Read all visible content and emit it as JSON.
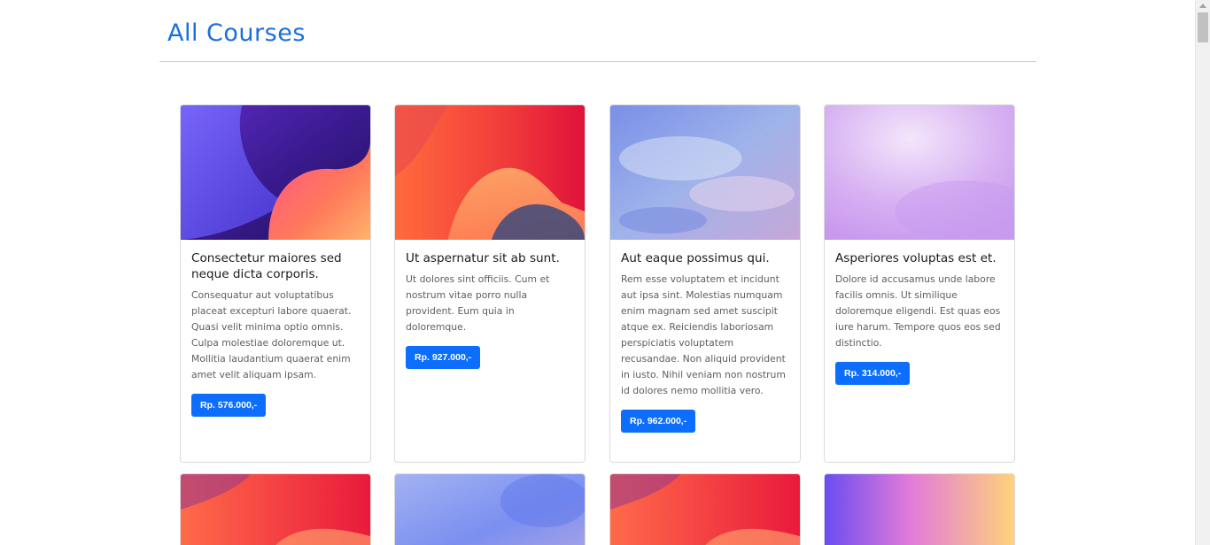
{
  "page": {
    "title": "All Courses"
  },
  "courses": [
    {
      "title": "Consectetur maiores sed neque dicta corporis.",
      "description": "Consequatur aut voluptatibus placeat excepturi labore quaerat. Quasi velit minima optio omnis. Culpa molestiae doloremque ut. Mollitia laudantium quaerat enim amet velit aliquam ipsam.",
      "price": "Rp. 576.000,-"
    },
    {
      "title": "Ut aspernatur sit ab sunt.",
      "description": "Ut dolores sint officiis. Cum et nostrum vitae porro nulla provident. Eum quia in doloremque.",
      "price": "Rp. 927.000,-"
    },
    {
      "title": "Aut eaque possimus qui.",
      "description": "Rem esse voluptatem et incidunt aut ipsa sint. Molestias numquam enim magnam sed amet suscipit atque ex. Reiciendis laboriosam perspiciatis voluptatem recusandae. Non aliquid provident in iusto. Nihil veniam non nostrum id dolores nemo mollitia vero.",
      "price": "Rp. 962.000,-"
    },
    {
      "title": "Asperiores voluptas est et.",
      "description": "Dolore id accusamus unde labore facilis omnis. Ut similique doloremque eligendi. Est quas eos iure harum. Tempore quos eos sed distinctio.",
      "price": "Rp. 314.000,-"
    }
  ],
  "colors": {
    "accent": "#0d6efd",
    "title": "#1a6fe0"
  }
}
